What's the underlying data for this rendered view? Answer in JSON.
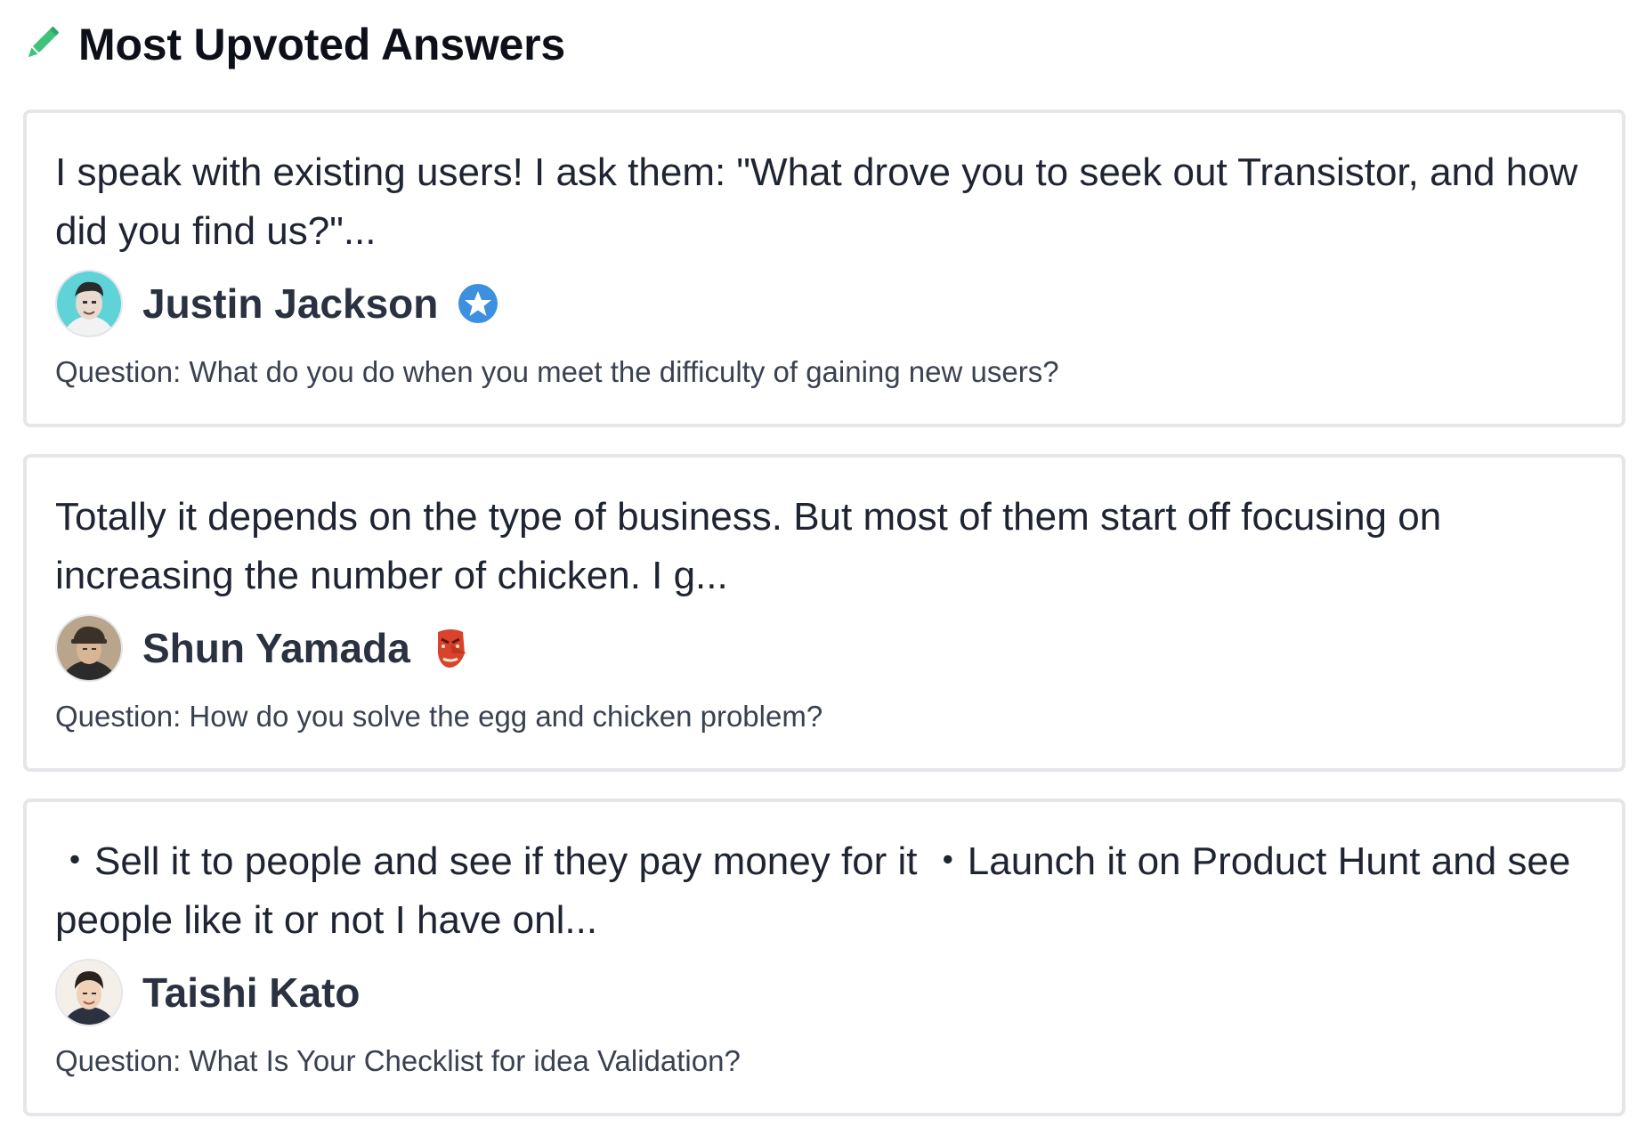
{
  "header": {
    "title": "Most Upvoted Answers",
    "icon": "pencil-icon",
    "icon_color": "#3fc27a"
  },
  "answers": [
    {
      "text": "I speak with existing users! I ask them: \"What drove you to seek out Transistor, and how did you find us?\"...",
      "author": "Justin Jackson",
      "badge": "blue-star-badge-icon",
      "question": "Question: What do you do when you meet the difficulty of gaining new users?"
    },
    {
      "text": "Totally it depends on the type of business. But most of them start off focusing on increasing the number of chicken. I g...",
      "author": "Shun Yamada",
      "badge": "tengu-mask-icon",
      "question": "Question: How do you solve the egg and chicken problem?"
    },
    {
      "text": "・Sell it to people and see if they pay money for it ・Launch it on Product Hunt and see people like it or not I have onl...",
      "author": "Taishi Kato",
      "badge": "",
      "question": "Question: What Is Your Checklist for idea Validation?"
    }
  ],
  "colors": {
    "card_border": "#e4e6ea",
    "text": "#1f2432",
    "badge_blue": "#3d8fe0",
    "tengu_red": "#d9432e"
  }
}
